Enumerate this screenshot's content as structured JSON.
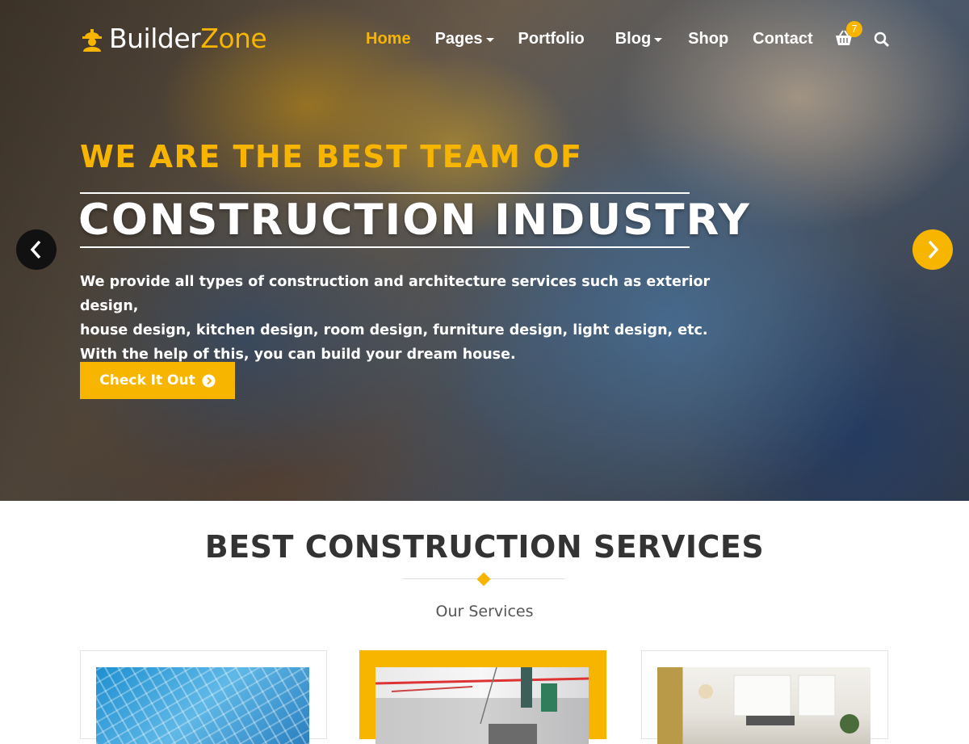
{
  "brand": {
    "name_part1": "Builder",
    "name_part2": "Zone",
    "accent_color": "#f7b500"
  },
  "nav": {
    "items": [
      {
        "label": "Home",
        "active": true,
        "has_dropdown": false
      },
      {
        "label": "Pages",
        "active": false,
        "has_dropdown": true
      },
      {
        "label": "Portfolio",
        "active": false,
        "has_dropdown": false
      },
      {
        "label": "Blog",
        "active": false,
        "has_dropdown": true
      },
      {
        "label": "Shop",
        "active": false,
        "has_dropdown": false
      },
      {
        "label": "Contact",
        "active": false,
        "has_dropdown": false
      }
    ],
    "cart_count": "7",
    "icons": [
      "cart-icon",
      "search-icon"
    ]
  },
  "hero": {
    "tagline": "WE ARE THE BEST TEAM OF",
    "headline": "CONSTRUCTION INDUSTRY",
    "description_lines": [
      "We provide all types of construction and architecture services such as exterior design,",
      "house design, kitchen design, room design, furniture design, light design, etc.",
      "With the help of this, you can build your dream house."
    ],
    "cta_label": "Check It Out",
    "prev_icon": "chevron-left-icon",
    "next_icon": "chevron-right-icon"
  },
  "services": {
    "title": "BEST CONSTRUCTION SERVICES",
    "subtitle": "Our Services",
    "cards": [
      {
        "image": "glass-building-image",
        "featured": false
      },
      {
        "image": "crane-construction-image",
        "featured": true
      },
      {
        "image": "interior-room-image",
        "featured": false
      }
    ]
  }
}
